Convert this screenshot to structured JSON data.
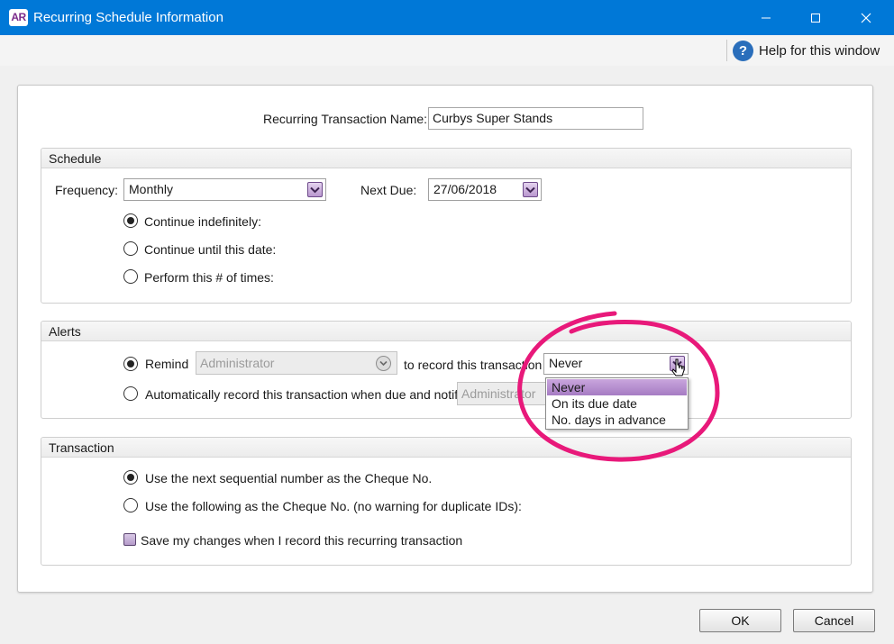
{
  "window": {
    "app_icon_text": "AR",
    "title": "Recurring Schedule Information"
  },
  "help": {
    "icon_text": "?",
    "label": "Help for this window"
  },
  "form": {
    "name_label": "Recurring Transaction Name:",
    "name_value": "Curbys Super Stands"
  },
  "schedule": {
    "title": "Schedule",
    "frequency_label": "Frequency:",
    "frequency_value": "Monthly",
    "next_due_label": "Next Due:",
    "next_due_value": "27/06/2018",
    "options": [
      {
        "label": "Continue indefinitely:",
        "checked": true
      },
      {
        "label": "Continue until this date:",
        "checked": false
      },
      {
        "label": "Perform this # of times:",
        "checked": false
      }
    ]
  },
  "alerts": {
    "title": "Alerts",
    "remind_label": "Remind",
    "remind_checked": true,
    "remind_user": "Administrator",
    "record_label": "to record this transaction",
    "when_value": "Never",
    "auto_label": "Automatically record this transaction when due and notify",
    "auto_checked": false,
    "auto_user": "Administrator",
    "dropdown_options": [
      "Never",
      "On its due date",
      "No. days in advance"
    ],
    "dropdown_selected": "Never"
  },
  "transaction": {
    "title": "Transaction",
    "options": [
      {
        "label": "Use the next sequential number as the Cheque No.",
        "checked": true
      },
      {
        "label": "Use the following as the Cheque No. (no warning for duplicate IDs):",
        "checked": false
      }
    ],
    "save_label": "Save my changes when I record this recurring transaction",
    "save_checked": false
  },
  "buttons": {
    "ok": "OK",
    "cancel": "Cancel"
  },
  "colors": {
    "titlebar": "#0078d7",
    "accent_purple": "#a67cc3",
    "annotation": "#e8197a"
  }
}
